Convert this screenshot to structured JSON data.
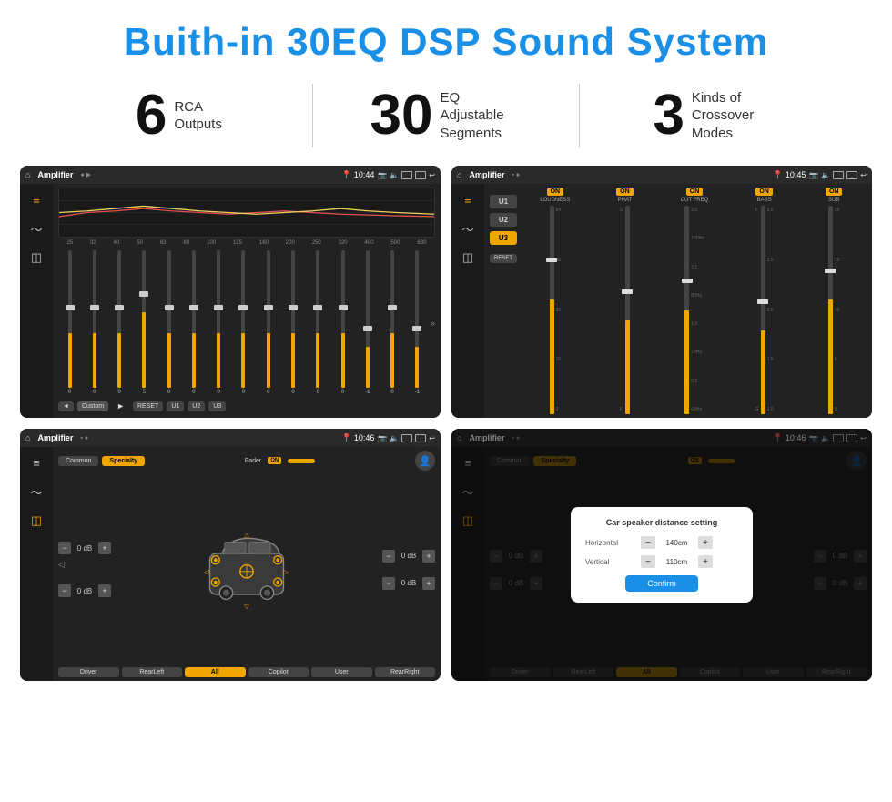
{
  "page": {
    "title": "Buith-in 30EQ DSP Sound System",
    "stats": [
      {
        "number": "6",
        "label": "RCA\nOutputs"
      },
      {
        "number": "30",
        "label": "EQ Adjustable\nSegments"
      },
      {
        "number": "3",
        "label": "Kinds of\nCrossover Modes"
      }
    ]
  },
  "screens": {
    "eq": {
      "title": "Amplifier",
      "time": "10:44",
      "preset": "Custom",
      "buttons": [
        "◄",
        "Custom",
        "►",
        "RESET",
        "U1",
        "U2",
        "U3"
      ],
      "frequencies": [
        "25",
        "32",
        "40",
        "50",
        "63",
        "80",
        "100",
        "125",
        "160",
        "200",
        "250",
        "320",
        "400",
        "500",
        "630"
      ],
      "values": [
        "0",
        "0",
        "0",
        "5",
        "0",
        "0",
        "0",
        "0",
        "0",
        "0",
        "0",
        "0",
        "-1",
        "0",
        "-1"
      ],
      "sliderPositions": [
        50,
        50,
        50,
        35,
        50,
        50,
        50,
        50,
        50,
        50,
        50,
        50,
        60,
        50,
        60
      ]
    },
    "crossover": {
      "title": "Amplifier",
      "time": "10:45",
      "presets": [
        "U1",
        "U2",
        "U3"
      ],
      "activePreset": "U3",
      "channels": [
        {
          "on": true,
          "label": "LOUDNESS",
          "ticks": [
            "64",
            "48",
            "32",
            "16",
            "0"
          ]
        },
        {
          "on": true,
          "label": "PHAT",
          "ticks": [
            "F",
            "",
            ""
          ]
        },
        {
          "on": true,
          "label": "CUT FREQ",
          "ticks": [
            "3.0",
            "2.1",
            "1.3",
            "0.5"
          ]
        },
        {
          "on": true,
          "label": "BASS",
          "ticks": [
            "3.0",
            "2.5",
            "2.0",
            "1.5",
            "1.0"
          ]
        },
        {
          "on": true,
          "label": "SUB",
          "ticks": [
            "20",
            "15",
            "10",
            "5",
            "0"
          ]
        }
      ]
    },
    "speaker1": {
      "title": "Amplifier",
      "time": "10:46",
      "tabs": [
        "Common",
        "Specialty"
      ],
      "activeTab": "Specialty",
      "faderLabel": "Fader",
      "faderOn": true,
      "dbValues": [
        "0 dB",
        "0 dB",
        "0 dB",
        "0 dB"
      ],
      "buttons": [
        "Driver",
        "RearLeft",
        "All",
        "Copilot",
        "RearRight",
        "User"
      ]
    },
    "speaker2": {
      "title": "Amplifier",
      "time": "10:46",
      "tabs": [
        "Common",
        "Specialty"
      ],
      "activeTab": "Specialty",
      "faderOn": true,
      "dbValues": [
        "0 dB",
        "0 dB"
      ],
      "buttons": [
        "Driver",
        "RearLeft",
        "All",
        "Copilot",
        "RearRight",
        "User"
      ],
      "dialog": {
        "title": "Car speaker distance setting",
        "fields": [
          {
            "label": "Horizontal",
            "value": "140cm"
          },
          {
            "label": "Vertical",
            "value": "110cm"
          }
        ],
        "confirmLabel": "Confirm"
      }
    }
  }
}
